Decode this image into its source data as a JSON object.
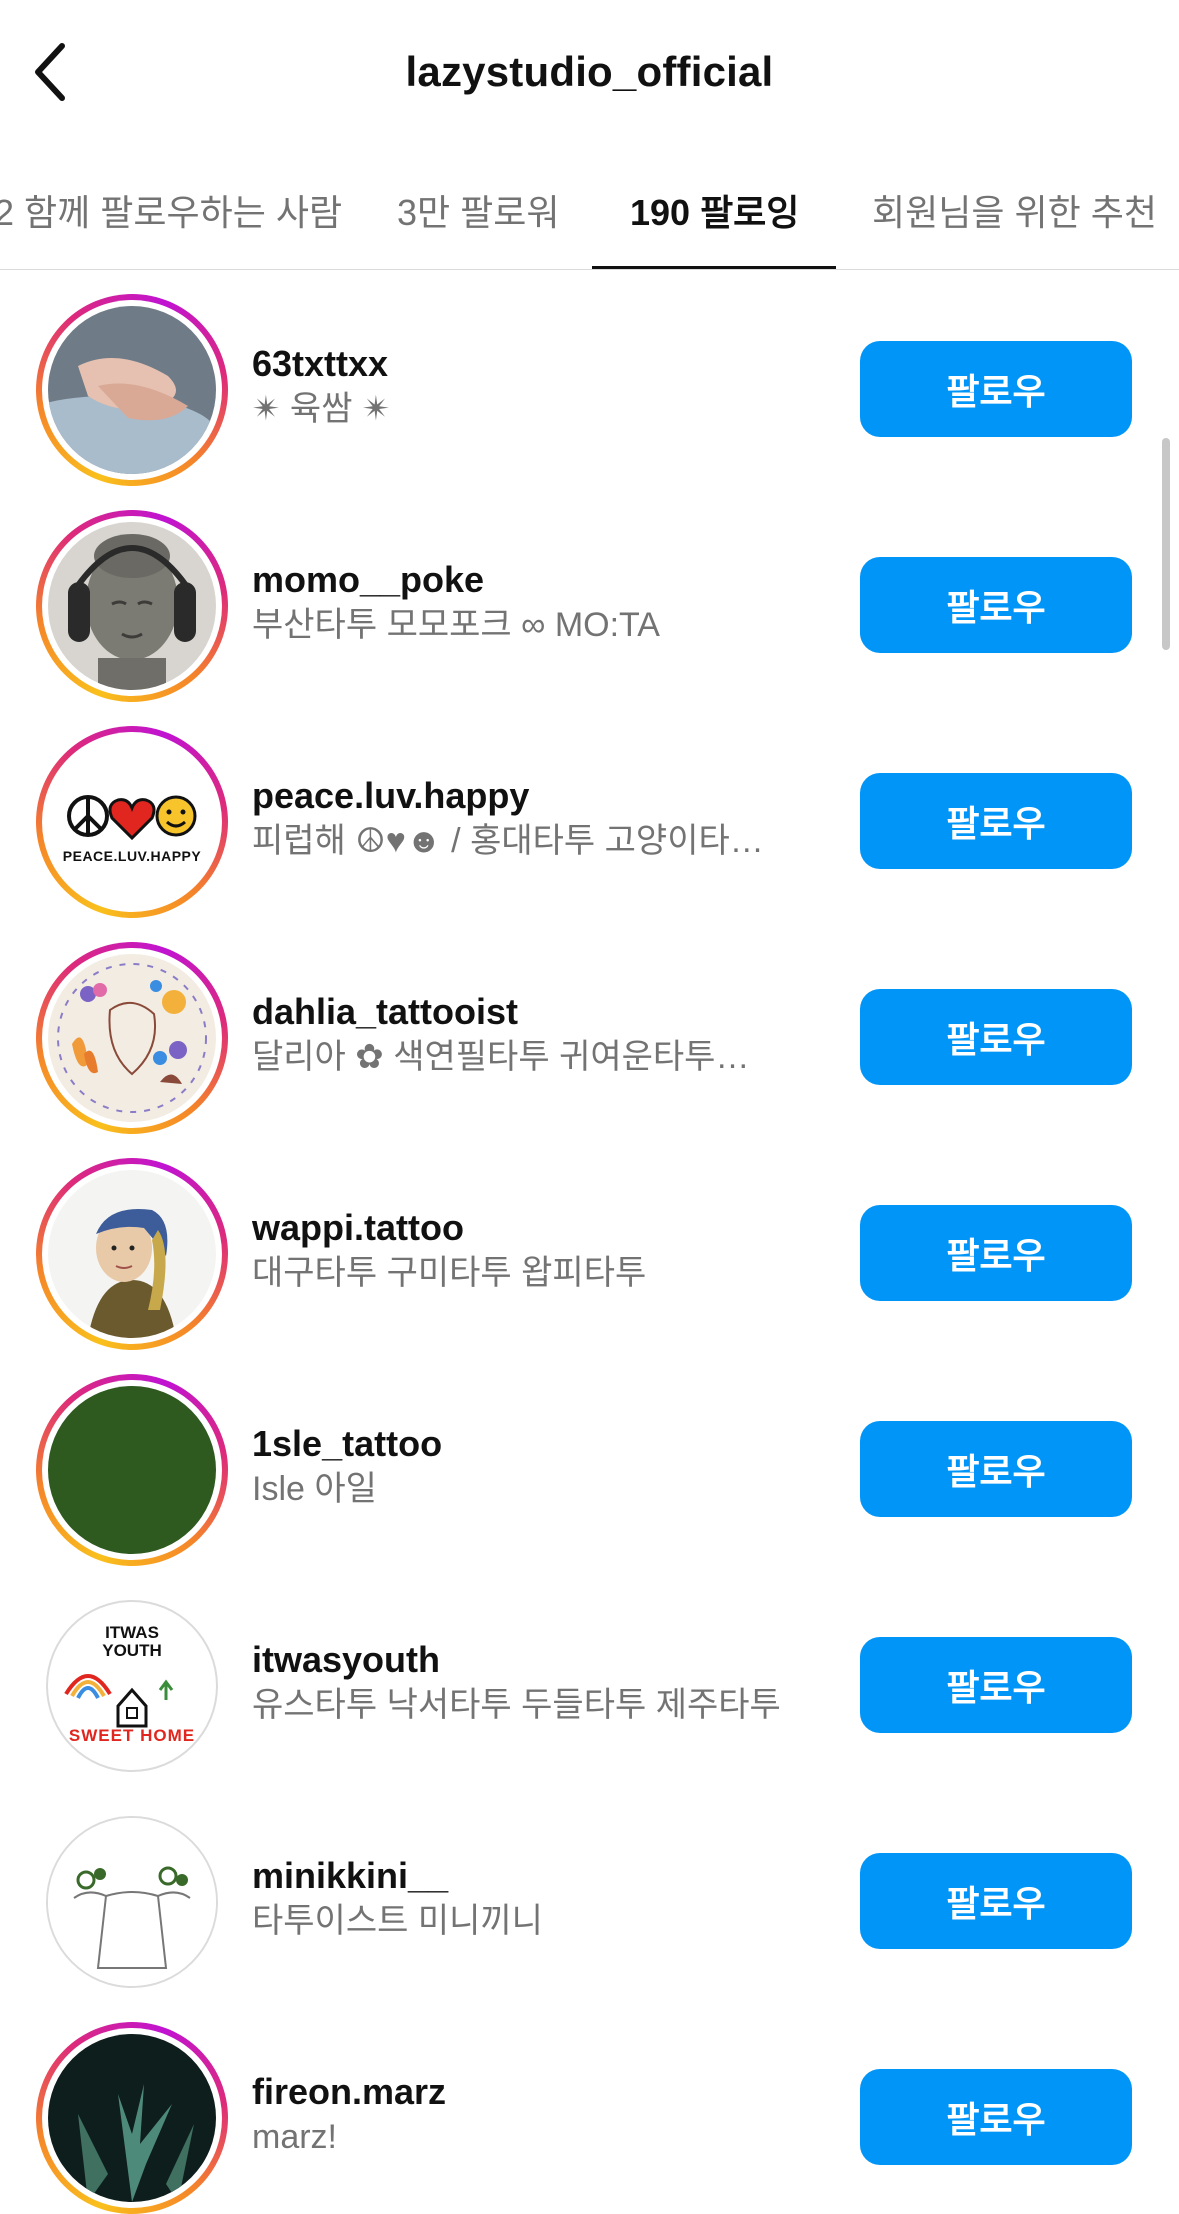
{
  "header": {
    "title": "lazystudio_official"
  },
  "tabs": [
    {
      "label": "2 함께 팔로우하는 사람",
      "active": false
    },
    {
      "label": "3만 팔로워",
      "active": false
    },
    {
      "label": "190 팔로잉",
      "active": true
    },
    {
      "label": "회원님을 위한 추천",
      "active": false
    }
  ],
  "accounts": [
    {
      "username": "63txttxx",
      "subtitle": "✴ 육쌈 ✴",
      "button": "팔로우",
      "story_ring": true
    },
    {
      "username": "momo__poke",
      "subtitle": "부산타투 모모포크 ∞ MO:TA",
      "button": "팔로우",
      "story_ring": true
    },
    {
      "username": "peace.luv.happy",
      "subtitle": "피럽해 ☮♥☻ / 홍대타투 고양이타…",
      "button": "팔로우",
      "story_ring": true,
      "avatar_text": "PEACE.LUV.HAPPY"
    },
    {
      "username": "dahlia_tattooist",
      "subtitle": "달리아 ✿ 색연필타투 귀여운타투…",
      "button": "팔로우",
      "story_ring": true
    },
    {
      "username": "wappi.tattoo",
      "subtitle": "대구타투 구미타투 왑피타투",
      "button": "팔로우",
      "story_ring": true
    },
    {
      "username": "1sle_tattoo",
      "subtitle": "Isle 아일",
      "button": "팔로우",
      "story_ring": true
    },
    {
      "username": "itwasyouth",
      "subtitle": "유스타투 낙서타투 두들타투 제주타투",
      "button": "팔로우",
      "story_ring": false,
      "avatar_text_top": "ITWAS YOUTH",
      "avatar_text_bottom": "SWEET HOME"
    },
    {
      "username": "minikkini__",
      "subtitle": "타투이스트 미니끼니",
      "button": "팔로우",
      "story_ring": false
    },
    {
      "username": "fireon.marz",
      "subtitle": "marz!",
      "button": "팔로우",
      "story_ring": true
    }
  ],
  "colors": {
    "follow_button": "#0095f6",
    "secondary_text": "#737373",
    "divider": "#dbdbdb"
  }
}
